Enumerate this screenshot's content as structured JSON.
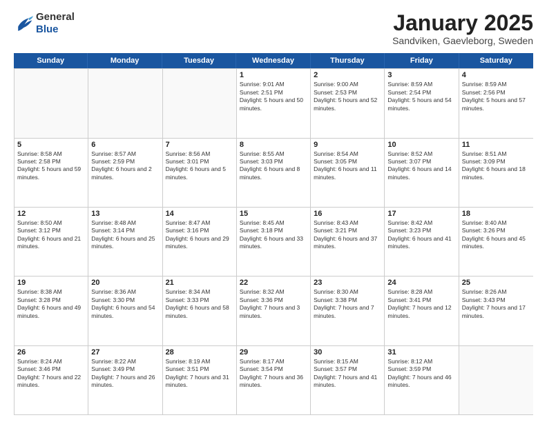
{
  "header": {
    "logo_general": "General",
    "logo_blue": "Blue",
    "month": "January 2025",
    "location": "Sandviken, Gaevleborg, Sweden"
  },
  "days_of_week": [
    "Sunday",
    "Monday",
    "Tuesday",
    "Wednesday",
    "Thursday",
    "Friday",
    "Saturday"
  ],
  "rows": [
    [
      {
        "day": "",
        "empty": true
      },
      {
        "day": "",
        "empty": true
      },
      {
        "day": "",
        "empty": true
      },
      {
        "day": "1",
        "sunrise": "Sunrise: 9:01 AM",
        "sunset": "Sunset: 2:51 PM",
        "daylight": "Daylight: 5 hours and 50 minutes."
      },
      {
        "day": "2",
        "sunrise": "Sunrise: 9:00 AM",
        "sunset": "Sunset: 2:53 PM",
        "daylight": "Daylight: 5 hours and 52 minutes."
      },
      {
        "day": "3",
        "sunrise": "Sunrise: 8:59 AM",
        "sunset": "Sunset: 2:54 PM",
        "daylight": "Daylight: 5 hours and 54 minutes."
      },
      {
        "day": "4",
        "sunrise": "Sunrise: 8:59 AM",
        "sunset": "Sunset: 2:56 PM",
        "daylight": "Daylight: 5 hours and 57 minutes."
      }
    ],
    [
      {
        "day": "5",
        "sunrise": "Sunrise: 8:58 AM",
        "sunset": "Sunset: 2:58 PM",
        "daylight": "Daylight: 5 hours and 59 minutes."
      },
      {
        "day": "6",
        "sunrise": "Sunrise: 8:57 AM",
        "sunset": "Sunset: 2:59 PM",
        "daylight": "Daylight: 6 hours and 2 minutes."
      },
      {
        "day": "7",
        "sunrise": "Sunrise: 8:56 AM",
        "sunset": "Sunset: 3:01 PM",
        "daylight": "Daylight: 6 hours and 5 minutes."
      },
      {
        "day": "8",
        "sunrise": "Sunrise: 8:55 AM",
        "sunset": "Sunset: 3:03 PM",
        "daylight": "Daylight: 6 hours and 8 minutes."
      },
      {
        "day": "9",
        "sunrise": "Sunrise: 8:54 AM",
        "sunset": "Sunset: 3:05 PM",
        "daylight": "Daylight: 6 hours and 11 minutes."
      },
      {
        "day": "10",
        "sunrise": "Sunrise: 8:52 AM",
        "sunset": "Sunset: 3:07 PM",
        "daylight": "Daylight: 6 hours and 14 minutes."
      },
      {
        "day": "11",
        "sunrise": "Sunrise: 8:51 AM",
        "sunset": "Sunset: 3:09 PM",
        "daylight": "Daylight: 6 hours and 18 minutes."
      }
    ],
    [
      {
        "day": "12",
        "sunrise": "Sunrise: 8:50 AM",
        "sunset": "Sunset: 3:12 PM",
        "daylight": "Daylight: 6 hours and 21 minutes."
      },
      {
        "day": "13",
        "sunrise": "Sunrise: 8:48 AM",
        "sunset": "Sunset: 3:14 PM",
        "daylight": "Daylight: 6 hours and 25 minutes."
      },
      {
        "day": "14",
        "sunrise": "Sunrise: 8:47 AM",
        "sunset": "Sunset: 3:16 PM",
        "daylight": "Daylight: 6 hours and 29 minutes."
      },
      {
        "day": "15",
        "sunrise": "Sunrise: 8:45 AM",
        "sunset": "Sunset: 3:18 PM",
        "daylight": "Daylight: 6 hours and 33 minutes."
      },
      {
        "day": "16",
        "sunrise": "Sunrise: 8:43 AM",
        "sunset": "Sunset: 3:21 PM",
        "daylight": "Daylight: 6 hours and 37 minutes."
      },
      {
        "day": "17",
        "sunrise": "Sunrise: 8:42 AM",
        "sunset": "Sunset: 3:23 PM",
        "daylight": "Daylight: 6 hours and 41 minutes."
      },
      {
        "day": "18",
        "sunrise": "Sunrise: 8:40 AM",
        "sunset": "Sunset: 3:26 PM",
        "daylight": "Daylight: 6 hours and 45 minutes."
      }
    ],
    [
      {
        "day": "19",
        "sunrise": "Sunrise: 8:38 AM",
        "sunset": "Sunset: 3:28 PM",
        "daylight": "Daylight: 6 hours and 49 minutes."
      },
      {
        "day": "20",
        "sunrise": "Sunrise: 8:36 AM",
        "sunset": "Sunset: 3:30 PM",
        "daylight": "Daylight: 6 hours and 54 minutes."
      },
      {
        "day": "21",
        "sunrise": "Sunrise: 8:34 AM",
        "sunset": "Sunset: 3:33 PM",
        "daylight": "Daylight: 6 hours and 58 minutes."
      },
      {
        "day": "22",
        "sunrise": "Sunrise: 8:32 AM",
        "sunset": "Sunset: 3:36 PM",
        "daylight": "Daylight: 7 hours and 3 minutes."
      },
      {
        "day": "23",
        "sunrise": "Sunrise: 8:30 AM",
        "sunset": "Sunset: 3:38 PM",
        "daylight": "Daylight: 7 hours and 7 minutes."
      },
      {
        "day": "24",
        "sunrise": "Sunrise: 8:28 AM",
        "sunset": "Sunset: 3:41 PM",
        "daylight": "Daylight: 7 hours and 12 minutes."
      },
      {
        "day": "25",
        "sunrise": "Sunrise: 8:26 AM",
        "sunset": "Sunset: 3:43 PM",
        "daylight": "Daylight: 7 hours and 17 minutes."
      }
    ],
    [
      {
        "day": "26",
        "sunrise": "Sunrise: 8:24 AM",
        "sunset": "Sunset: 3:46 PM",
        "daylight": "Daylight: 7 hours and 22 minutes."
      },
      {
        "day": "27",
        "sunrise": "Sunrise: 8:22 AM",
        "sunset": "Sunset: 3:49 PM",
        "daylight": "Daylight: 7 hours and 26 minutes."
      },
      {
        "day": "28",
        "sunrise": "Sunrise: 8:19 AM",
        "sunset": "Sunset: 3:51 PM",
        "daylight": "Daylight: 7 hours and 31 minutes."
      },
      {
        "day": "29",
        "sunrise": "Sunrise: 8:17 AM",
        "sunset": "Sunset: 3:54 PM",
        "daylight": "Daylight: 7 hours and 36 minutes."
      },
      {
        "day": "30",
        "sunrise": "Sunrise: 8:15 AM",
        "sunset": "Sunset: 3:57 PM",
        "daylight": "Daylight: 7 hours and 41 minutes."
      },
      {
        "day": "31",
        "sunrise": "Sunrise: 8:12 AM",
        "sunset": "Sunset: 3:59 PM",
        "daylight": "Daylight: 7 hours and 46 minutes."
      },
      {
        "day": "",
        "empty": true
      }
    ]
  ]
}
